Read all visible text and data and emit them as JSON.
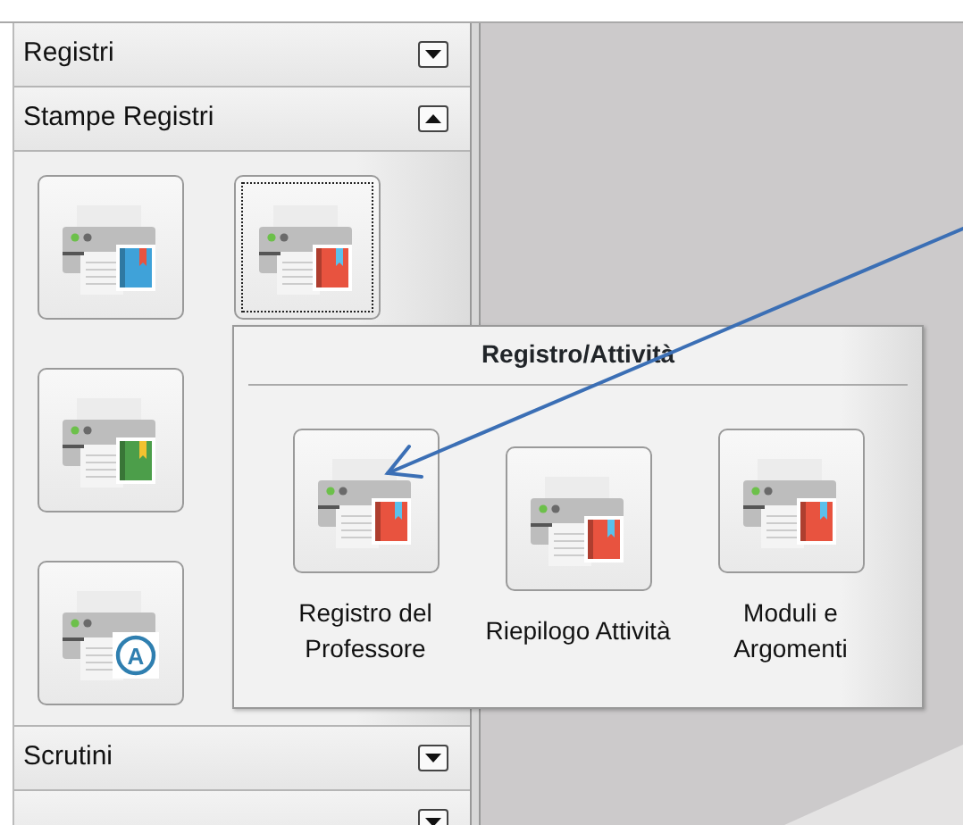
{
  "sidebar": {
    "sections": [
      {
        "title": "Registri",
        "expanded": false
      },
      {
        "title": "Stampe Registri",
        "expanded": true,
        "buttons": [
          {
            "kind": "book",
            "color": "#3fa2d9",
            "focused": false
          },
          {
            "kind": "book",
            "color": "#e8533f",
            "focused": true
          },
          {
            "kind": "book",
            "color": "#4c9e4a",
            "focused": false
          },
          {
            "kind": "badge",
            "badge_text": "A",
            "focused": false
          }
        ]
      },
      {
        "title": "Scrutini",
        "expanded": false
      },
      {
        "expanded": false
      }
    ]
  },
  "popup": {
    "title": "Registro/Attività",
    "items": [
      {
        "label": "Registro del Professore",
        "color": "#e8533f"
      },
      {
        "label": "Riepilogo Attività",
        "color": "#e8533f"
      },
      {
        "label": "Moduli e Argomenti",
        "color": "#e8533f"
      }
    ]
  }
}
